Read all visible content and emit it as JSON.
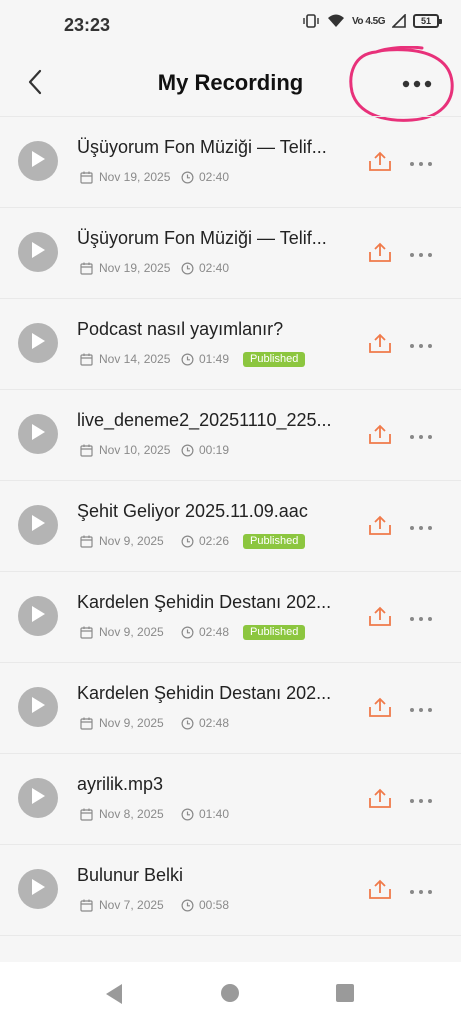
{
  "status_bar": {
    "time": "23:23",
    "network_label": "Vo 4.5G",
    "battery_level": "51"
  },
  "header": {
    "title": "My Recording"
  },
  "recordings": [
    {
      "title": "Üşüyorum Fon Müziği — Telif...",
      "date": "Nov 19, 2025",
      "duration": "02:40",
      "status": ""
    },
    {
      "title": "Üşüyorum Fon Müziği — Telif...",
      "date": "Nov 19, 2025",
      "duration": "02:40",
      "status": ""
    },
    {
      "title": "Podcast nasıl yayımlanır?",
      "date": "Nov 14, 2025",
      "duration": "01:49",
      "status": "Published"
    },
    {
      "title": "live_deneme2_20251110_225...",
      "date": "Nov 10, 2025",
      "duration": "00:19",
      "status": ""
    },
    {
      "title": "Şehit Geliyor 2025.11.09.aac",
      "date": "Nov 9, 2025",
      "duration": "02:26",
      "status": "Published"
    },
    {
      "title": "Kardelen Şehidin Destanı 202...",
      "date": "Nov 9, 2025",
      "duration": "02:48",
      "status": "Published"
    },
    {
      "title": "Kardelen Şehidin Destanı 202...",
      "date": "Nov 9, 2025",
      "duration": "02:48",
      "status": ""
    },
    {
      "title": "ayrilik.mp3",
      "date": "Nov 8, 2025",
      "duration": "01:40",
      "status": ""
    },
    {
      "title": "Bulunur Belki",
      "date": "Nov 7, 2025",
      "duration": "00:58",
      "status": ""
    }
  ],
  "colors": {
    "accent": "#f07a4a",
    "published": "#8cc63f",
    "annotation": "#e8317a"
  },
  "icons": {
    "back": "chevron-left-icon",
    "more": "more-horizontal-icon",
    "play": "play-icon",
    "calendar": "calendar-icon",
    "clock": "clock-icon",
    "upload": "upload-icon"
  }
}
